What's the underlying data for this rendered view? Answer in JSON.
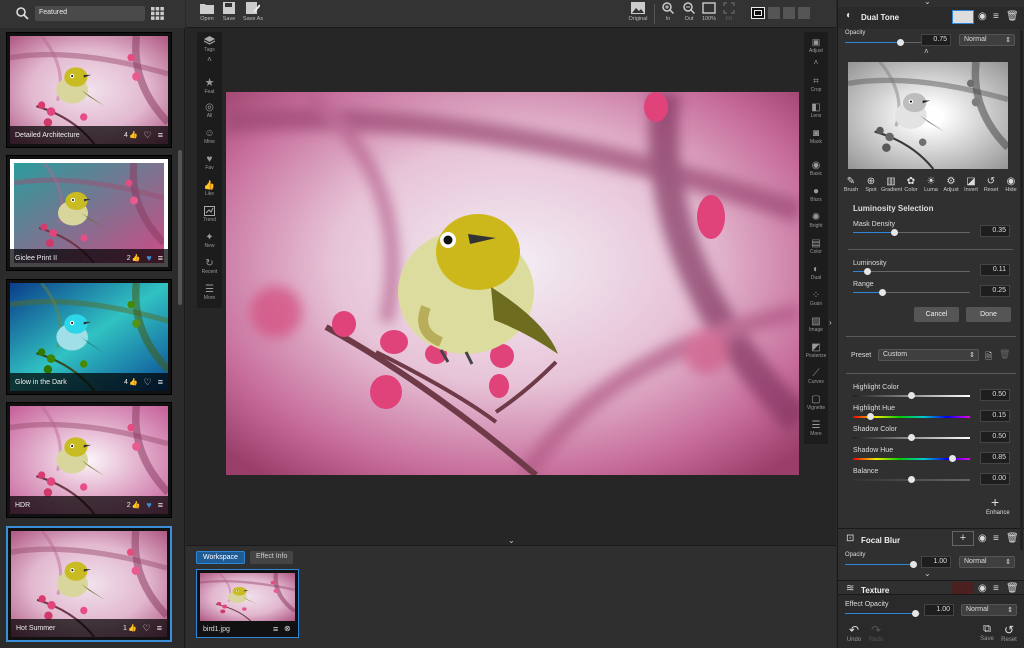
{
  "search": {
    "value": "Featured"
  },
  "browser": {
    "items": [
      {
        "title": "Detailed Architecture",
        "likes": "4",
        "liked": false
      },
      {
        "title": "Giclee Print II",
        "likes": "2",
        "liked": true
      },
      {
        "title": "Glow in the Dark",
        "likes": "4",
        "liked": false
      },
      {
        "title": "HDR",
        "likes": "2",
        "liked": true
      },
      {
        "title": "Hot Summer",
        "likes": "1",
        "liked": false
      }
    ]
  },
  "toolbar": {
    "open": "Open",
    "save": "Save",
    "save_as": "Save As",
    "original": "Original",
    "in": "In",
    "out": "Out",
    "zoom_100": "100%",
    "fit": "Fit"
  },
  "left_tools": [
    "Tags",
    "Feat",
    "All",
    "Mine",
    "Fav",
    "Like",
    "Trend",
    "New",
    "Recent",
    "More"
  ],
  "right_tools": [
    "Adjust",
    "Crop",
    "Lens",
    "Mask",
    "Basic",
    "Blurs",
    "Bright",
    "Color",
    "Dual",
    "Grain",
    "Image",
    "Posterize",
    "Curves",
    "Vignette",
    "More"
  ],
  "bottom": {
    "tab_workspace": "Workspace",
    "tab_effect_info": "Effect Info",
    "file_name": "bird1.jpg"
  },
  "panel": {
    "dual_tone": {
      "title": "Dual Tone",
      "opacity_label": "Opacity",
      "opacity": "0.75",
      "opacity_level": 0.75,
      "blend": "Normal"
    },
    "mask_tools": [
      "Brush",
      "Spot",
      "Gradient",
      "Color",
      "Luma",
      "Adjust",
      "Invert",
      "Reset",
      "Hide"
    ],
    "lum": {
      "title": "Luminosity Selection",
      "mask_density_label": "Mask Density",
      "mask_density": "0.35",
      "luminosity_label": "Luminosity",
      "luminosity": "0.11",
      "range_label": "Range",
      "range": "0.25",
      "cancel": "Cancel",
      "done": "Done"
    },
    "preset_label": "Preset",
    "preset": "Custom",
    "sliders": [
      {
        "label": "Highlight Color",
        "value": "0.50",
        "level": 0.5
      },
      {
        "label": "Highlight Hue",
        "value": "0.15",
        "level": 0.15
      },
      {
        "label": "Shadow Color",
        "value": "0.50",
        "level": 0.5
      },
      {
        "label": "Shadow Hue",
        "value": "0.85",
        "level": 0.85
      },
      {
        "label": "Balance",
        "value": "0.00",
        "level": 0.5
      }
    ],
    "enhance": "Enhance",
    "focal_blur": {
      "title": "Focal Blur",
      "opacity_label": "Opacity",
      "opacity": "1.00",
      "blend": "Normal"
    },
    "texture": {
      "title": "Texture"
    },
    "effect_opacity_label": "Effect Opacity",
    "effect_opacity": "1.00",
    "effect_blend": "Normal",
    "undo": "Undo",
    "redo": "Redo",
    "save": "Save",
    "reset": "Reset"
  },
  "colors": {
    "accent": "#2e86d6",
    "panel": "#303030",
    "bg": "#2a2a2a"
  }
}
